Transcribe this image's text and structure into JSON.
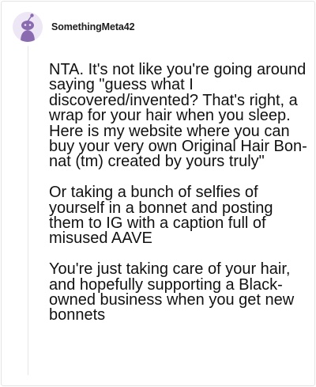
{
  "comment": {
    "username": "SomethingMeta42",
    "avatar_icon": "snoo-avatar-icon",
    "paragraphs": [
      "NTA. It's not like you're going around saying \"guess what I discovered/invented? That's right, a wrap for your hair when you sleep. Here is my website where you can buy your very own Original Hair Bon-nat (tm) created by yours truly\"",
      "Or taking a bunch of selfies of yourself in a bonnet and posting them to IG with a caption full of misused AAVE",
      "You're just taking care of your hair, and hopefully supporting a Black-owned business when you get new bonnets"
    ]
  },
  "colors": {
    "avatar_bg": "#ede6f5",
    "avatar_figure": "#8a6bb0",
    "text": "#111111",
    "thread_line": "#e6e6e6"
  }
}
